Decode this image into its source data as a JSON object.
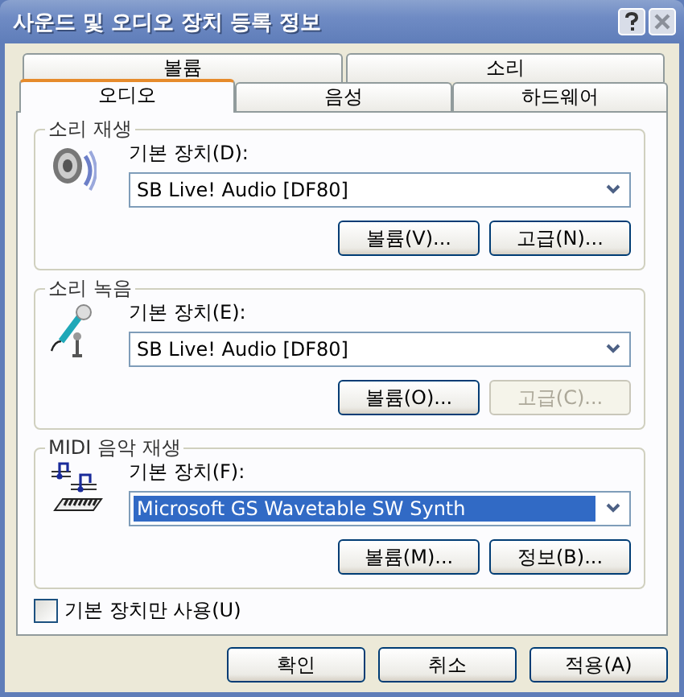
{
  "window": {
    "title": "사운드 및 오디오 장치 등록 정보"
  },
  "tab_rows": [
    [
      {
        "label": "볼륨",
        "selected": false
      },
      {
        "label": "소리",
        "selected": false
      }
    ],
    [
      {
        "label": "오디오",
        "selected": true
      },
      {
        "label": "음성",
        "selected": false
      },
      {
        "label": "하드웨어",
        "selected": false
      }
    ]
  ],
  "groups": [
    {
      "title": "소리 재생",
      "kind": "playback",
      "device_label": "기본 장치(D):",
      "dropdown": {
        "value": "SB Live! Audio [DF80]",
        "highlighted": false
      },
      "buttons": [
        {
          "label": "볼륨(V)...",
          "disabled": false
        },
        {
          "label": "고급(N)...",
          "disabled": false
        }
      ]
    },
    {
      "title": "소리 녹음",
      "kind": "recording",
      "device_label": "기본 장치(E):",
      "dropdown": {
        "value": "SB Live! Audio [DF80]",
        "highlighted": false
      },
      "buttons": [
        {
          "label": "볼륨(O)...",
          "disabled": false
        },
        {
          "label": "고급(C)...",
          "disabled": true
        }
      ]
    },
    {
      "title": "MIDI 음악 재생",
      "kind": "midi",
      "device_label": "기본 장치(F):",
      "dropdown": {
        "value": "Microsoft GS Wavetable SW Synth",
        "highlighted": true
      },
      "buttons": [
        {
          "label": "볼륨(M)...",
          "disabled": false
        },
        {
          "label": "정보(B)...",
          "disabled": false
        }
      ]
    }
  ],
  "checkbox": {
    "label": "기본 장치만 사용(U)",
    "checked": false
  },
  "buttons": [
    "확인",
    "취소",
    "적용(A)"
  ]
}
